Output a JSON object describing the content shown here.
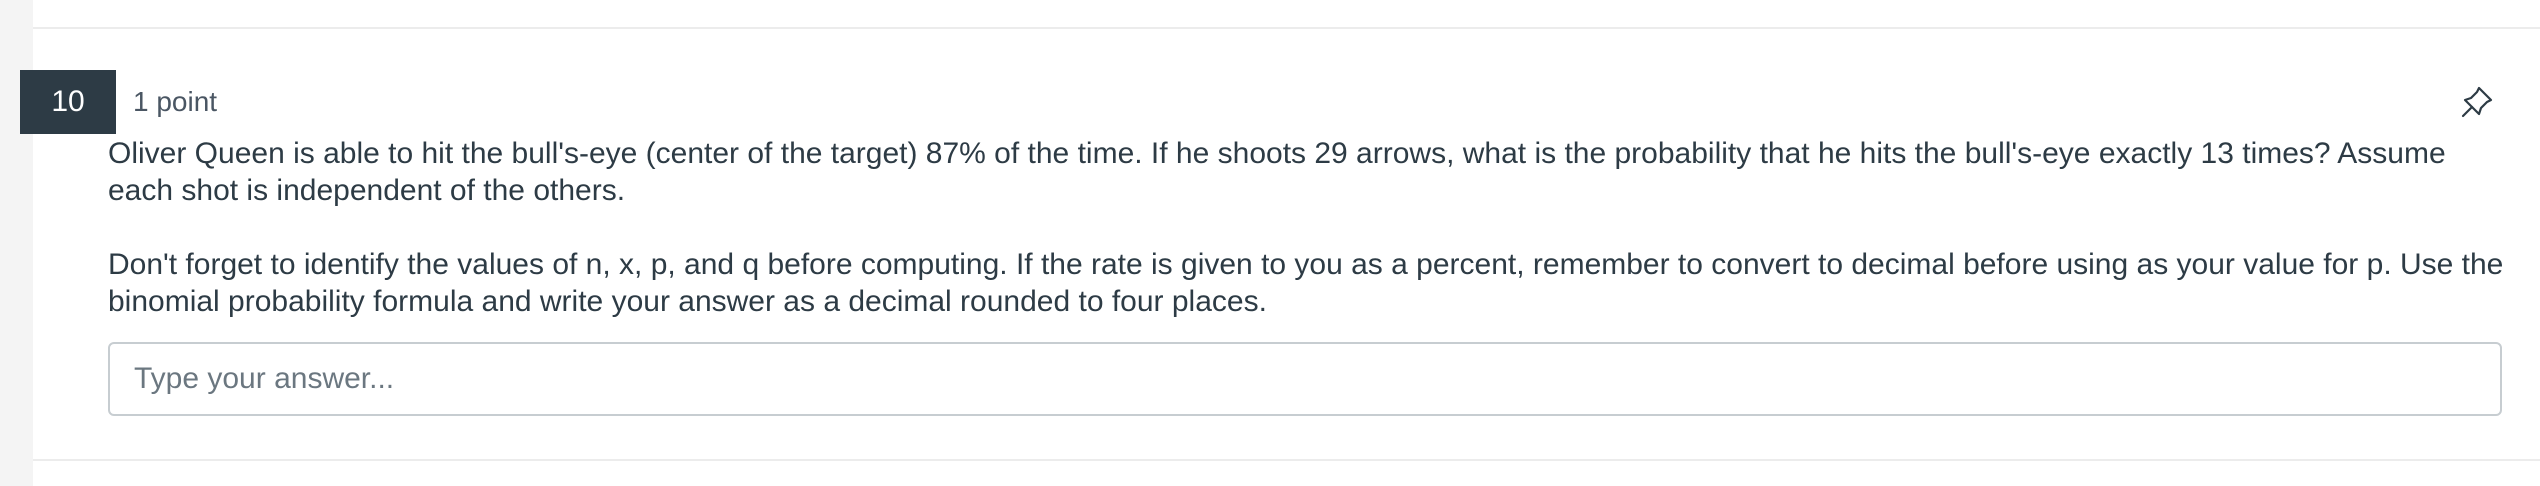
{
  "question": {
    "number": "10",
    "points": "1 point",
    "paragraph_1": "Oliver Queen is able to hit the bull's-eye (center of the target) 87% of the time. If he shoots 29 arrows, what is the probability that he hits the bull's-eye exactly 13 times? Assume each shot is independent of the others.",
    "paragraph_2": "Don't forget to identify the values of n, x, p, and q before computing. If the rate is given to you as a percent, remember to convert to decimal before using as your value for p. Use the binomial probability formula and write your answer as a decimal rounded to four places.",
    "answer_placeholder": "Type your answer...",
    "answer_value": "",
    "pin_icon": "pin-icon"
  },
  "colors": {
    "badge_bg": "#2d3b45",
    "text": "#2d3b45",
    "border": "#c7cdd1"
  }
}
